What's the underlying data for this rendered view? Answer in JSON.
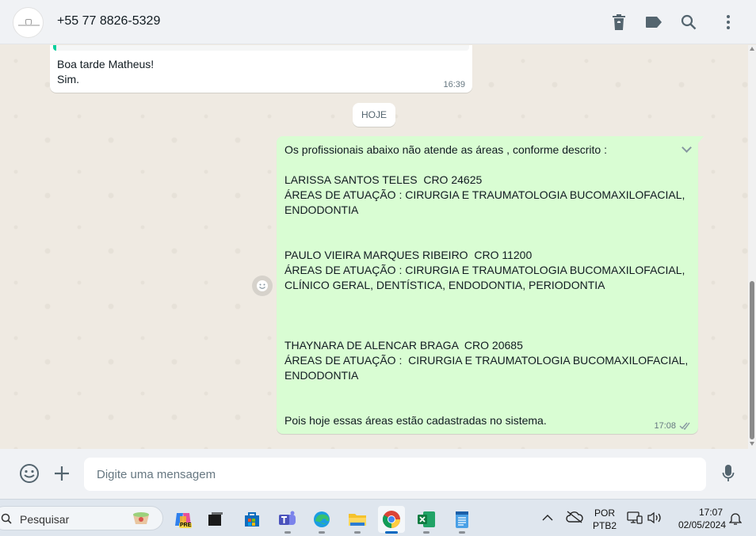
{
  "header": {
    "contact_name": "+55 77 8826-5329",
    "icons": [
      "trash-icon",
      "label-icon",
      "search-icon",
      "menu-icon"
    ]
  },
  "messages": {
    "incoming": {
      "line1": "Boa tarde Matheus!",
      "line2": "Sim.",
      "time": "16:39"
    },
    "date_divider": "HOJE",
    "outgoing": {
      "text": "Os profissionais abaixo não atende as áreas , conforme descrito :\n\nLARISSA SANTOS TELES  CRO 24625\nÁREAS DE ATUAÇÃO : CIRURGIA E TRAUMATOLOGIA BUCOMAXILOFACIAL,\nENDODONTIA\n\n\nPAULO VIEIRA MARQUES RIBEIRO  CRO 11200\nÁREAS DE ATUAÇÃO : CIRURGIA E TRAUMATOLOGIA BUCOMAXILOFACIAL,\nCLÍNICO GERAL, DENTÍSTICA, ENDODONTIA, PERIODONTIA\n\n\n\nTHAYNARA DE ALENCAR BRAGA  CRO 20685\nÁREAS DE ATUAÇÃO :  CIRURGIA E TRAUMATOLOGIA BUCOMAXILOFACIAL,\nENDODONTIA\n\n\nPois hoje essas áreas estão cadastradas no sistema.",
      "time": "17:08",
      "status": "read"
    }
  },
  "composer": {
    "placeholder": "Digite uma mensagem"
  },
  "taskbar": {
    "search_placeholder": "Pesquisar",
    "apps": [
      "copilot",
      "task-view",
      "store",
      "teams",
      "edge",
      "file-explorer",
      "chrome",
      "excel",
      "notepad"
    ],
    "active_app": "chrome",
    "lang_line1": "POR",
    "lang_line2": "PTB2",
    "time": "17:07",
    "date": "02/05/2024"
  },
  "colors": {
    "outgoing_bubble": "#d9fdd3",
    "incoming_bubble": "#ffffff",
    "chat_background": "#efeae2",
    "accent": "#06cf9c",
    "read_ticks": "#53bdeb"
  }
}
